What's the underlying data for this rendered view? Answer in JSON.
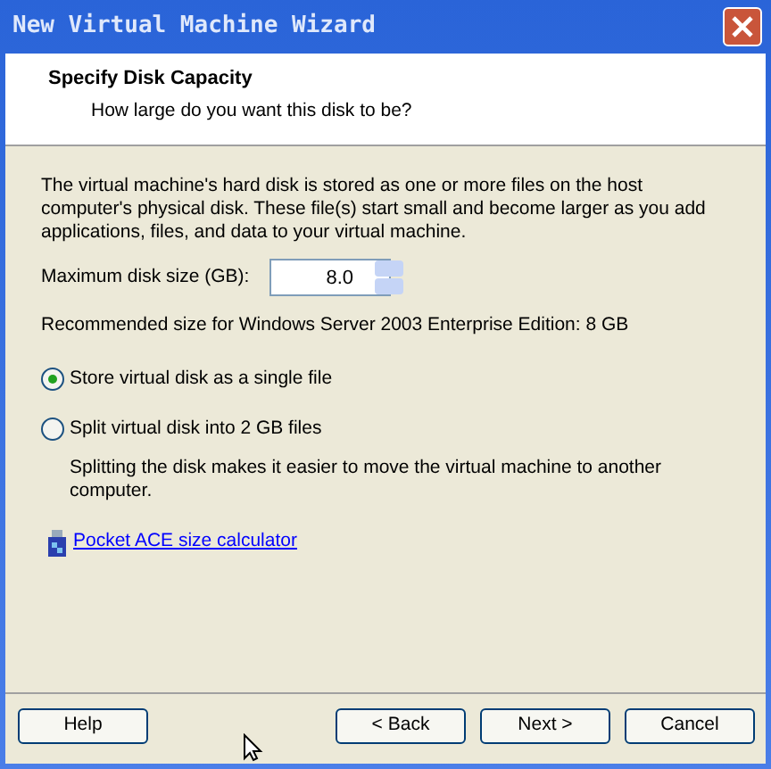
{
  "window": {
    "title": "New Virtual Machine Wizard"
  },
  "header": {
    "title": "Specify Disk Capacity",
    "subtitle": "How large do you want this disk to be?"
  },
  "description": "The virtual machine's hard disk is stored as one or more files on the host computer's physical disk. These file(s) start small and become larger as you add applications, files, and data to your virtual machine.",
  "disk_size": {
    "label": "Maximum disk size (GB):",
    "value": "8.0"
  },
  "recommendation": "Recommended size for Windows Server 2003 Enterprise Edition: 8 GB",
  "options": [
    {
      "label": "Store virtual disk as a single file",
      "selected": true
    },
    {
      "label": "Split virtual disk into 2 GB files",
      "selected": false,
      "note": "Splitting the disk makes it easier to move the virtual machine to another computer."
    }
  ],
  "link": "Pocket ACE size calculator",
  "buttons": {
    "left": [
      "Help"
    ],
    "right": [
      "< Back",
      "Next >",
      "Cancel"
    ]
  }
}
